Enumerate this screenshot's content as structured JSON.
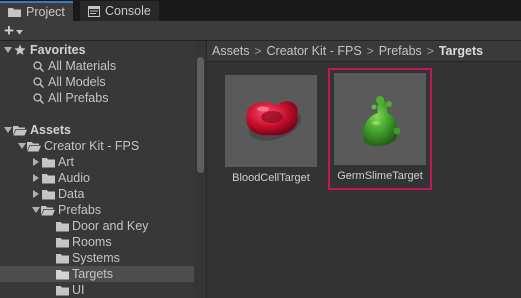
{
  "tabs": [
    {
      "label": "Project",
      "icon": "folder-icon",
      "active": true
    },
    {
      "label": "Console",
      "icon": "console-icon",
      "active": false
    }
  ],
  "toolbar": {
    "add_label": "+",
    "add_dropdown_icon": "chevron-down-icon"
  },
  "tree": {
    "favorites": {
      "label": "Favorites",
      "items": [
        "All Materials",
        "All Models",
        "All Prefabs"
      ]
    },
    "assets": {
      "label": "Assets",
      "creator_kit": "Creator Kit - FPS",
      "children": [
        "Art",
        "Audio",
        "Data",
        "Prefabs"
      ],
      "prefab_children": [
        "Door and Key",
        "Rooms",
        "Systems",
        "Targets",
        "UI"
      ],
      "selected": "Targets"
    }
  },
  "breadcrumb": {
    "items": [
      "Assets",
      "Creator Kit - FPS",
      "Prefabs"
    ],
    "current": "Targets",
    "separator": ">"
  },
  "assets_grid": [
    {
      "name": "BloodCellTarget",
      "selected": false,
      "color": "#c8102e"
    },
    {
      "name": "GermSlimeTarget",
      "selected": true,
      "color": "#3d9b2a"
    }
  ],
  "colors": {
    "selection_border": "#c2185b",
    "tab_accent": "#3a79bb"
  }
}
